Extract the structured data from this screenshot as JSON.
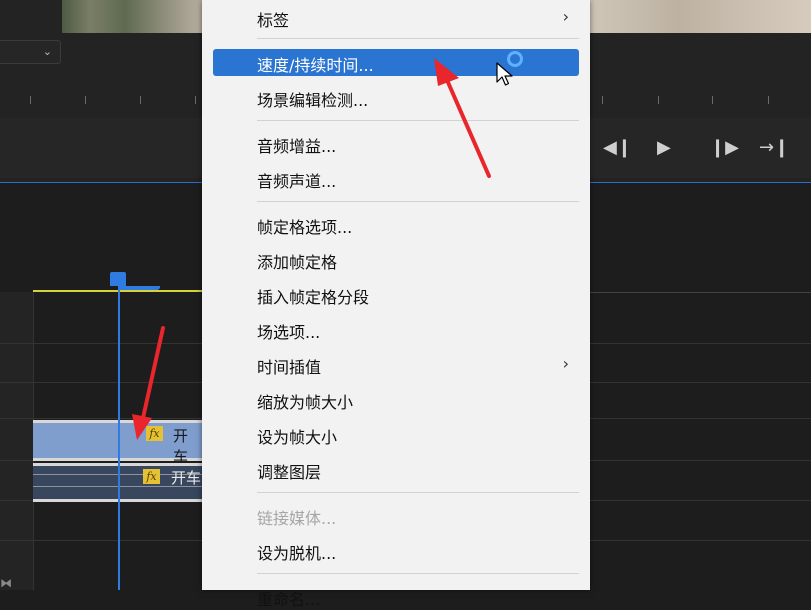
{
  "background_panel": {
    "dropdown_chevron": "chevron-down-icon",
    "transport_controls": [
      {
        "icon": "step-back-icon",
        "glyph": "◀❙"
      },
      {
        "icon": "play-icon",
        "glyph": "▶"
      },
      {
        "icon": "step-forward-icon",
        "glyph": "❙▶"
      },
      {
        "icon": "go-to-out-icon",
        "glyph": "→❙"
      }
    ]
  },
  "timeline": {
    "clips": [
      {
        "name": "开车",
        "track": "video",
        "fx_label": "fx"
      },
      {
        "name": "开车",
        "track": "audio",
        "fx_label": "fx"
      }
    ]
  },
  "context_menu": {
    "items": [
      {
        "label": "标签",
        "submenu": true,
        "state": "normal"
      },
      {
        "label": "速度/持续时间...",
        "submenu": false,
        "state": "highlighted"
      },
      {
        "label": "场景编辑检测...",
        "submenu": false,
        "state": "normal"
      },
      {
        "label": "音频增益...",
        "submenu": false,
        "state": "normal"
      },
      {
        "label": "音频声道...",
        "submenu": false,
        "state": "normal"
      },
      {
        "label": "帧定格选项...",
        "submenu": false,
        "state": "normal"
      },
      {
        "label": "添加帧定格",
        "submenu": false,
        "state": "normal"
      },
      {
        "label": "插入帧定格分段",
        "submenu": false,
        "state": "normal"
      },
      {
        "label": "场选项...",
        "submenu": false,
        "state": "normal"
      },
      {
        "label": "时间插值",
        "submenu": true,
        "state": "normal"
      },
      {
        "label": "缩放为帧大小",
        "submenu": false,
        "state": "normal"
      },
      {
        "label": "设为帧大小",
        "submenu": false,
        "state": "normal"
      },
      {
        "label": "调整图层",
        "submenu": false,
        "state": "normal"
      },
      {
        "label": "链接媒体...",
        "submenu": false,
        "state": "disabled"
      },
      {
        "label": "设为脱机...",
        "submenu": false,
        "state": "normal"
      },
      {
        "label": "重命名...",
        "submenu": false,
        "state": "normal"
      }
    ],
    "submenu_arrow": "›"
  },
  "colors": {
    "highlight": "#2a74d2",
    "annotation_arrow": "#e8262b",
    "playhead": "#2f7be0",
    "fx_badge": "#e3c234"
  }
}
